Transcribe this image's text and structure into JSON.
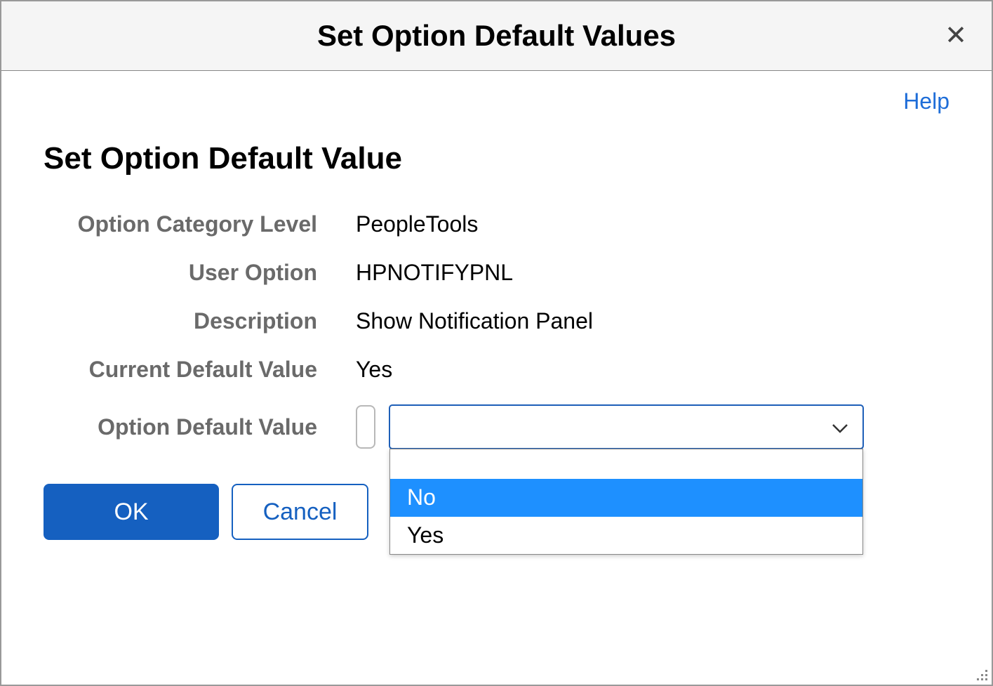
{
  "header": {
    "title": "Set Option Default Values"
  },
  "links": {
    "help": "Help"
  },
  "page": {
    "title": "Set Option Default Value"
  },
  "form": {
    "option_category_level": {
      "label": "Option Category Level",
      "value": "PeopleTools"
    },
    "user_option": {
      "label": "User Option",
      "value": "HPNOTIFYPNL"
    },
    "description": {
      "label": "Description",
      "value": "Show Notification Panel"
    },
    "current_default_value": {
      "label": "Current Default Value",
      "value": "Yes"
    },
    "option_default_value": {
      "label": "Option Default Value",
      "selected": "",
      "options": [
        "",
        "No",
        "Yes"
      ],
      "highlighted": "No"
    }
  },
  "buttons": {
    "ok": "OK",
    "cancel": "Cancel"
  }
}
